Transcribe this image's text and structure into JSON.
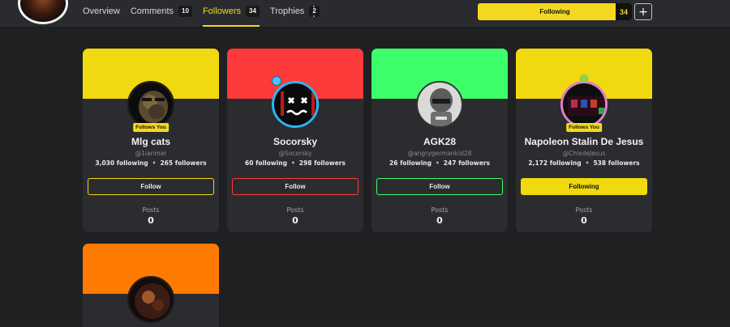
{
  "tabs": [
    {
      "label": "Overview",
      "count": ""
    },
    {
      "label": "Comments",
      "count": "10"
    },
    {
      "label": "Followers",
      "count": "34"
    },
    {
      "label": "Trophies",
      "count": "2"
    }
  ],
  "header": {
    "following_label": "Following",
    "following_count": "34",
    "plus_label": "+"
  },
  "colors": {
    "accent": "#f4d820",
    "background": "#1f2022",
    "card": "#2b2c30"
  },
  "cards": [
    {
      "name": "Mlg cats",
      "handle": "@1ianmar",
      "following": "3,030 following",
      "followers": "265 followers",
      "follows_you": "Follows You",
      "button": "Follow",
      "posts_label": "Posts",
      "posts": "0",
      "banner": "#f1d90f"
    },
    {
      "name": "Socorsky",
      "handle": "@Socorsky",
      "following": "60 following",
      "followers": "298 followers",
      "follows_you": "",
      "button": "Follow",
      "posts_label": "Posts",
      "posts": "0",
      "banner": "#ff3a3a"
    },
    {
      "name": "AGK28",
      "handle": "@angrygermankid28",
      "following": "26 following",
      "followers": "247 followers",
      "follows_you": "",
      "button": "Follow",
      "posts_label": "Posts",
      "posts": "0",
      "banner": "#3dff6a"
    },
    {
      "name": "Napoleon Stalin De Jesus",
      "handle": "@ChixdeJesus",
      "following": "2,172 following",
      "followers": "538 followers",
      "follows_you": "Follows You",
      "button": "Following",
      "posts_label": "Posts",
      "posts": "0",
      "banner": "#f1d90f"
    },
    {
      "name": "",
      "handle": "",
      "following": "",
      "followers": "",
      "follows_you": "",
      "button": "",
      "posts_label": "",
      "posts": "",
      "banner": "#ff7a00"
    }
  ],
  "separator": "•"
}
